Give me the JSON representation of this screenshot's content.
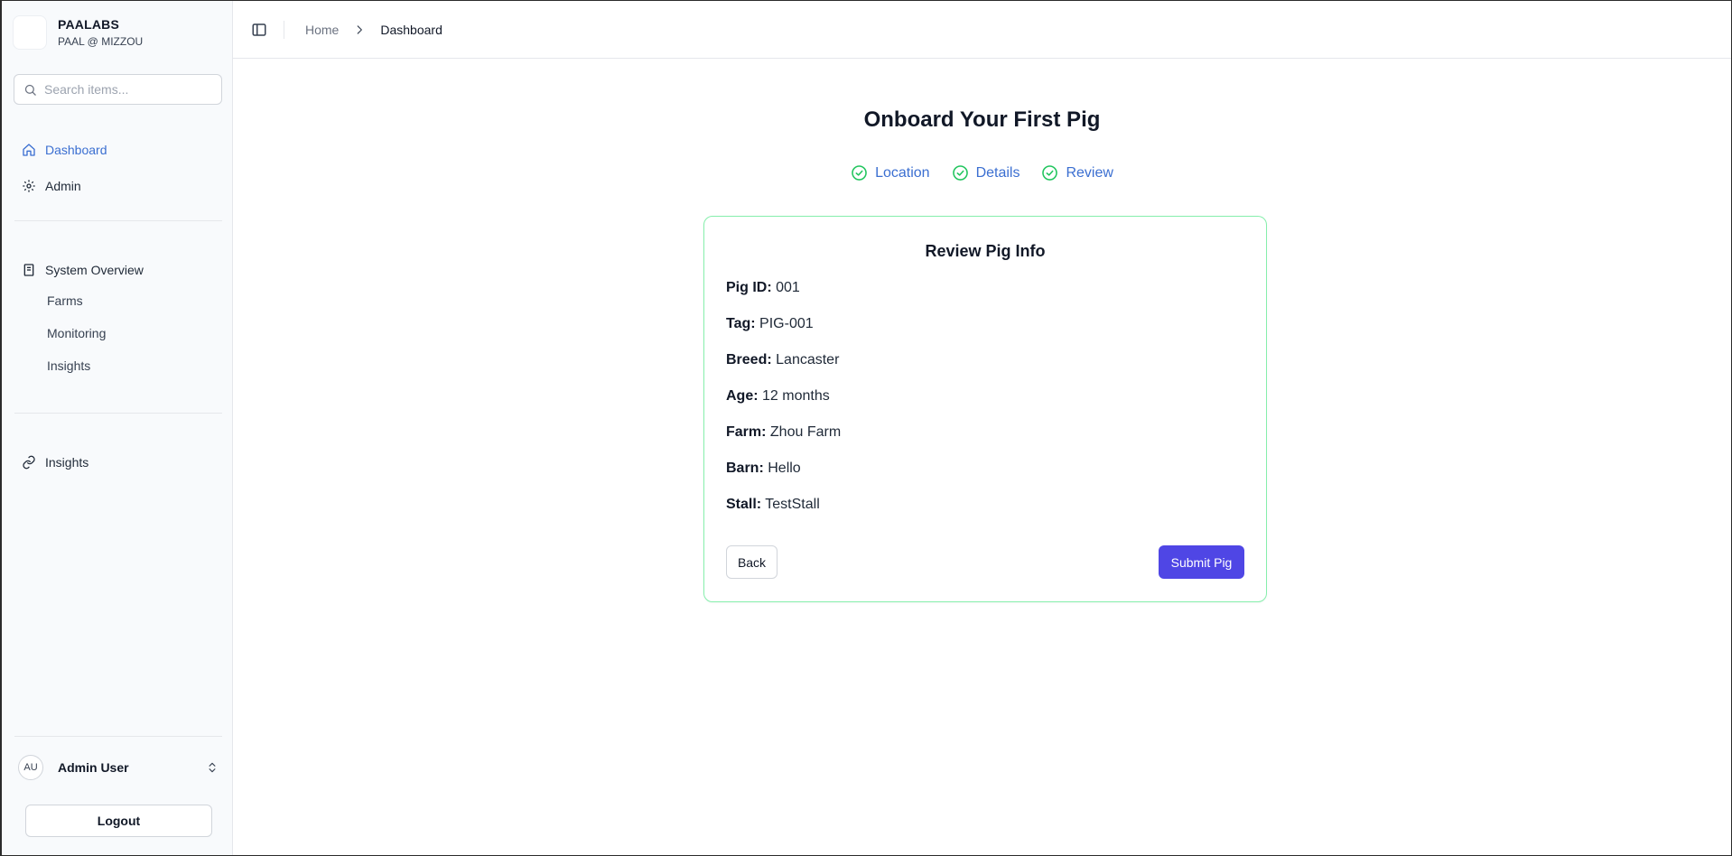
{
  "brand": {
    "name": "PAALABS",
    "subtitle": "PAAL @ MIZZOU"
  },
  "search": {
    "placeholder": "Search items..."
  },
  "nav": {
    "primary": [
      {
        "label": "Dashboard",
        "icon": "home-icon",
        "active": true
      },
      {
        "label": "Admin",
        "icon": "gear-icon",
        "active": false
      }
    ],
    "system_overview": {
      "label": "System Overview",
      "icon": "book-icon",
      "items": [
        "Farms",
        "Monitoring",
        "Insights"
      ]
    },
    "links": [
      {
        "label": "Insights",
        "icon": "link-icon"
      }
    ]
  },
  "user": {
    "initials": "AU",
    "name": "Admin User"
  },
  "logout_label": "Logout",
  "breadcrumb": {
    "home": "Home",
    "current": "Dashboard"
  },
  "page": {
    "title": "Onboard Your First Pig",
    "steps": [
      "Location",
      "Details",
      "Review"
    ]
  },
  "review": {
    "title": "Review Pig Info",
    "fields": [
      {
        "label": "Pig ID:",
        "value": "001"
      },
      {
        "label": "Tag:",
        "value": "PIG-001"
      },
      {
        "label": "Breed:",
        "value": "Lancaster"
      },
      {
        "label": "Age:",
        "value": "12 months"
      },
      {
        "label": "Farm:",
        "value": "Zhou Farm"
      },
      {
        "label": "Barn:",
        "value": "Hello"
      },
      {
        "label": "Stall:",
        "value": "TestStall"
      }
    ],
    "back_label": "Back",
    "submit_label": "Submit Pig"
  },
  "colors": {
    "accent_blue": "#3b6fd1",
    "step_check_green": "#22c55e",
    "card_border": "#86efac",
    "primary_button": "#4f46e5"
  }
}
